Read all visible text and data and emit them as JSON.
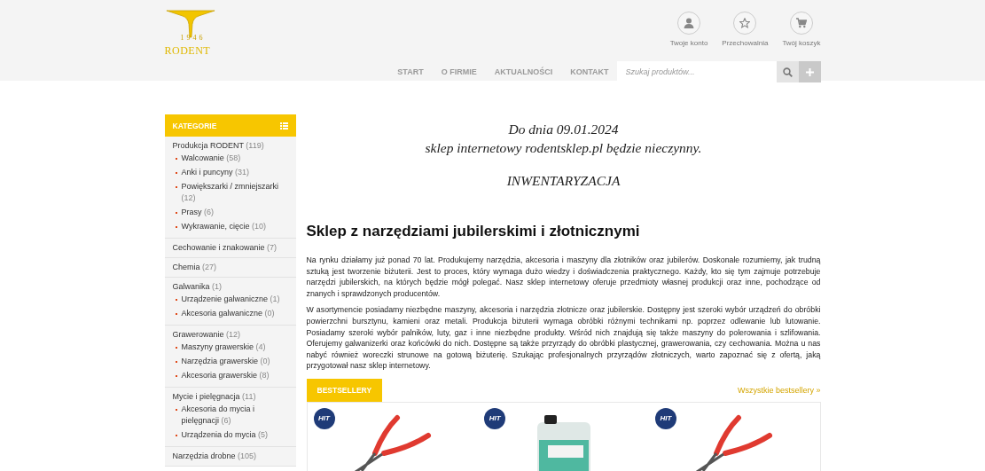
{
  "logo": {
    "year": "1946",
    "name": "RODENT"
  },
  "account_links": [
    {
      "kind": "user",
      "label": "Twoje konto"
    },
    {
      "kind": "star",
      "label": "Przechowalnia"
    },
    {
      "kind": "cart",
      "label": "Twój koszyk"
    }
  ],
  "nav": [
    {
      "label": "START"
    },
    {
      "label": "O FIRMIE"
    },
    {
      "label": "AKTUALNOŚCI"
    },
    {
      "label": "KONTAKT"
    }
  ],
  "search": {
    "placeholder": "Szukaj produktów..."
  },
  "sidebar": {
    "title": "KATEGORIE",
    "categories": [
      {
        "name": "Produkcja RODENT",
        "count": "(119)",
        "children": [
          {
            "name": "Walcowanie",
            "count": "(58)"
          },
          {
            "name": "Anki i puncyny",
            "count": "(31)"
          },
          {
            "name": "Powiększarki / zmniejszarki",
            "count": "(12)"
          },
          {
            "name": "Prasy",
            "count": "(6)"
          },
          {
            "name": "Wykrawanie, cięcie",
            "count": "(10)"
          }
        ]
      },
      {
        "name": "Cechowanie i znakowanie",
        "count": "(7)"
      },
      {
        "name": "Chemia",
        "count": "(27)"
      },
      {
        "name": "Galwanika",
        "count": "(1)",
        "children": [
          {
            "name": "Urządzenie galwaniczne",
            "count": "(1)"
          },
          {
            "name": "Akcesoria galwaniczne",
            "count": "(0)"
          }
        ]
      },
      {
        "name": "Grawerowanie",
        "count": "(12)",
        "children": [
          {
            "name": "Maszyny grawerskie",
            "count": "(4)"
          },
          {
            "name": "Narzędzia grawerskie",
            "count": "(0)"
          },
          {
            "name": "Akcesoria grawerskie",
            "count": "(8)"
          }
        ]
      },
      {
        "name": "Mycie i pielęgnacja",
        "count": "(11)",
        "children": [
          {
            "name": "Akcesoria do mycia i pielęgnacji",
            "count": "(6)"
          },
          {
            "name": "Urządzenia do mycia",
            "count": "(5)"
          }
        ]
      },
      {
        "name": "Narzędzia drobne",
        "count": "(105)"
      }
    ]
  },
  "notice": {
    "lines": [
      "Do dnia 09.01.2024",
      "sklep internetowy rodentsklep.pl będzie nieczynny."
    ],
    "emphasis": "INWENTARYZACJA"
  },
  "heading": "Sklep z narzędziami jubilerskimi i złotnicznymi",
  "paragraphs": [
    "Na rynku działamy już ponad 70 lat. Produkujemy narzędzia, akcesoria i maszyny dla złotników oraz jubilerów. Doskonale rozumiemy, jak trudną sztuką jest tworzenie biżuterii. Jest to proces, który wymaga dużo wiedzy i doświadczenia praktycznego. Każdy, kto się tym zajmuje potrzebuje narzędzi jubilerskich, na których będzie mógł polegać. Nasz sklep internetowy oferuje przedmioty własnej produkcji oraz inne, pochodzące od znanych i sprawdzonych producentów.",
    "W asortymencie posiadamy niezbędne maszyny, akcesoria i narzędzia złotnicze oraz jubilerskie. Dostępny jest szeroki wybór urządzeń do obróbki powierzchni bursztynu, kamieni oraz metali. Produkcja biżuterii wymaga obróbki różnymi technikami np. poprzez odlewanie lub lutowanie. Posiadamy szeroki wybór palników, luty, gaz i inne niezbędne produkty. Wśród nich znajdują się także maszyny do polerowania i szlifowania. Oferujemy galwanizerki oraz końcówki do nich. Dostępne są także przyrządy do obróbki plastycznej, grawerowania, czy cechowania. Można u nas nabyć również woreczki strunowe na gotową biżuterię. Szukając profesjonalnych przyrządów złotniczych, warto zapoznać się z ofertą, jaką przygotował nasz sklep internetowy."
  ],
  "bestsellers": {
    "tab": "BESTSELLERY",
    "all_link": "Wszystkie bestsellery »",
    "products": [
      {
        "badge": "HIT",
        "kind": "pliers"
      },
      {
        "badge": "HIT",
        "kind": "bottle"
      },
      {
        "badge": "HIT",
        "kind": "pliers"
      }
    ]
  }
}
